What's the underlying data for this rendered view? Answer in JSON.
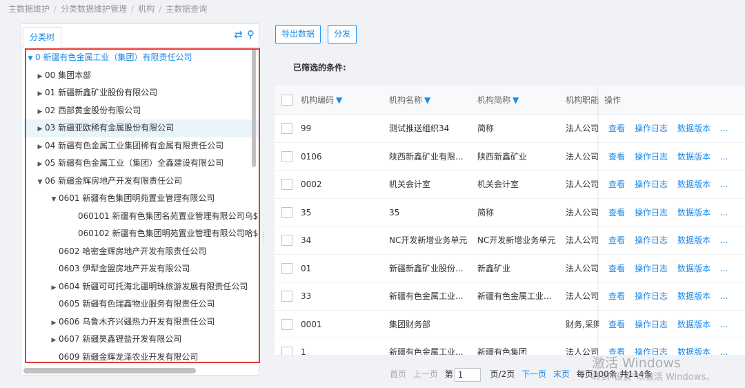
{
  "breadcrumb": [
    "主数据维护",
    "分类数据维护管理",
    "机构",
    "主数据查询"
  ],
  "left_panel": {
    "tab_label": "分类树",
    "icons": [
      "swap-icon",
      "search-icon"
    ],
    "tree": [
      {
        "label": "0 新疆有色金属工业（集团）有限责任公司",
        "depth": 0,
        "arrow": "expanded",
        "root": true
      },
      {
        "label": "00 集团本部",
        "depth": 1,
        "arrow": "collapsed"
      },
      {
        "label": "01 新疆新鑫矿业股份有限公司",
        "depth": 1,
        "arrow": "collapsed"
      },
      {
        "label": "02 西部黄金股份有限公司",
        "depth": 1,
        "arrow": "collapsed"
      },
      {
        "label": "03 新疆亚欧稀有金属股份有限公司",
        "depth": 1,
        "arrow": "collapsed",
        "active": true
      },
      {
        "label": "04 新疆有色金属工业集团稀有金属有限责任公司",
        "depth": 1,
        "arrow": "collapsed"
      },
      {
        "label": "05 新疆有色金属工业（集团）全鑫建设有限公司",
        "depth": 1,
        "arrow": "collapsed"
      },
      {
        "label": "06 新疆金辉房地产开发有限责任公司",
        "depth": 1,
        "arrow": "expanded"
      },
      {
        "label": "0601 新疆有色集团明苑置业管理有限公司",
        "depth": 2,
        "arrow": "expanded"
      },
      {
        "label": "060101 新疆有色集团名苑置业管理有限公司乌$",
        "depth": 3,
        "arrow": "none"
      },
      {
        "label": "060102 新疆有色集团明苑置业管理有限公司哈$",
        "depth": 3,
        "arrow": "none"
      },
      {
        "label": "0602 哈密金辉房地产开发有限责任公司",
        "depth": 2,
        "arrow": "none"
      },
      {
        "label": "0603 伊犁金盟房地产开发有限公司",
        "depth": 2,
        "arrow": "none"
      },
      {
        "label": "0604 新疆可可托海北疆明珠旅游发展有限责任公司",
        "depth": 2,
        "arrow": "collapsed"
      },
      {
        "label": "0605 新疆有色瑞鑫物业服务有限责任公司",
        "depth": 2,
        "arrow": "none"
      },
      {
        "label": "0606 乌鲁木齐兴疆热力开发有限责任公司",
        "depth": 2,
        "arrow": "collapsed"
      },
      {
        "label": "0607 新疆昊鑫锂盐开发有限公司",
        "depth": 2,
        "arrow": "collapsed"
      },
      {
        "label": "0609 新疆金辉龙泽农业开发有限公司",
        "depth": 2,
        "arrow": "none"
      }
    ]
  },
  "toolbar": {
    "export_label": "导出数据",
    "distribute_label": "分发"
  },
  "filter_label": "已筛选的条件:",
  "table": {
    "headers": {
      "code": "机构编码",
      "name": "机构名称",
      "short": "机构简称",
      "duty": "机构职能",
      "ops": "操作"
    },
    "op_labels": {
      "view": "查看",
      "log": "操作日志",
      "version": "数据版本",
      "more": "..."
    },
    "rows": [
      {
        "code": "99",
        "name": "测试推送组织34",
        "short": "简称",
        "duty": "法人公司,"
      },
      {
        "code": "0106",
        "name": "陕西新鑫矿业有限...",
        "short": "陕西新鑫矿业",
        "duty": "法人公司,"
      },
      {
        "code": "0002",
        "name": "机关会计室",
        "short": "机关会计室",
        "duty": "法人公司,"
      },
      {
        "code": "35",
        "name": "35",
        "short": "简称",
        "duty": "法人公司,"
      },
      {
        "code": "34",
        "name": "NC开发新增业务单元",
        "short": "NC开发新增业务单元",
        "duty": "法人公司,"
      },
      {
        "code": "01",
        "name": "新疆新鑫矿业股份...",
        "short": "新鑫矿业",
        "duty": "法人公司,"
      },
      {
        "code": "33",
        "name": "新疆有色金属工业...",
        "short": "新疆有色金属工业...",
        "duty": "法人公司,"
      },
      {
        "code": "0001",
        "name": "集团财务部",
        "short": "",
        "duty": "财务,采购"
      },
      {
        "code": "1",
        "name": "新疆有色金属工业...",
        "short": "新疆有色集团",
        "duty": "法人公司,"
      }
    ]
  },
  "pager": {
    "first": "首页",
    "prev": "上一页",
    "page_prefix": "第",
    "page_value": "1",
    "page_suffix": "页/2页",
    "next": "下一页",
    "last": "末页",
    "summary": "每页100条 共114条"
  },
  "watermark": {
    "line1": "激活 Windows",
    "line2": "转到\"设置\"以激活 Windows。"
  },
  "colors": {
    "accent": "#1e88e5",
    "highlight_box": "#e53935",
    "active_row": "#eaf4fb"
  }
}
